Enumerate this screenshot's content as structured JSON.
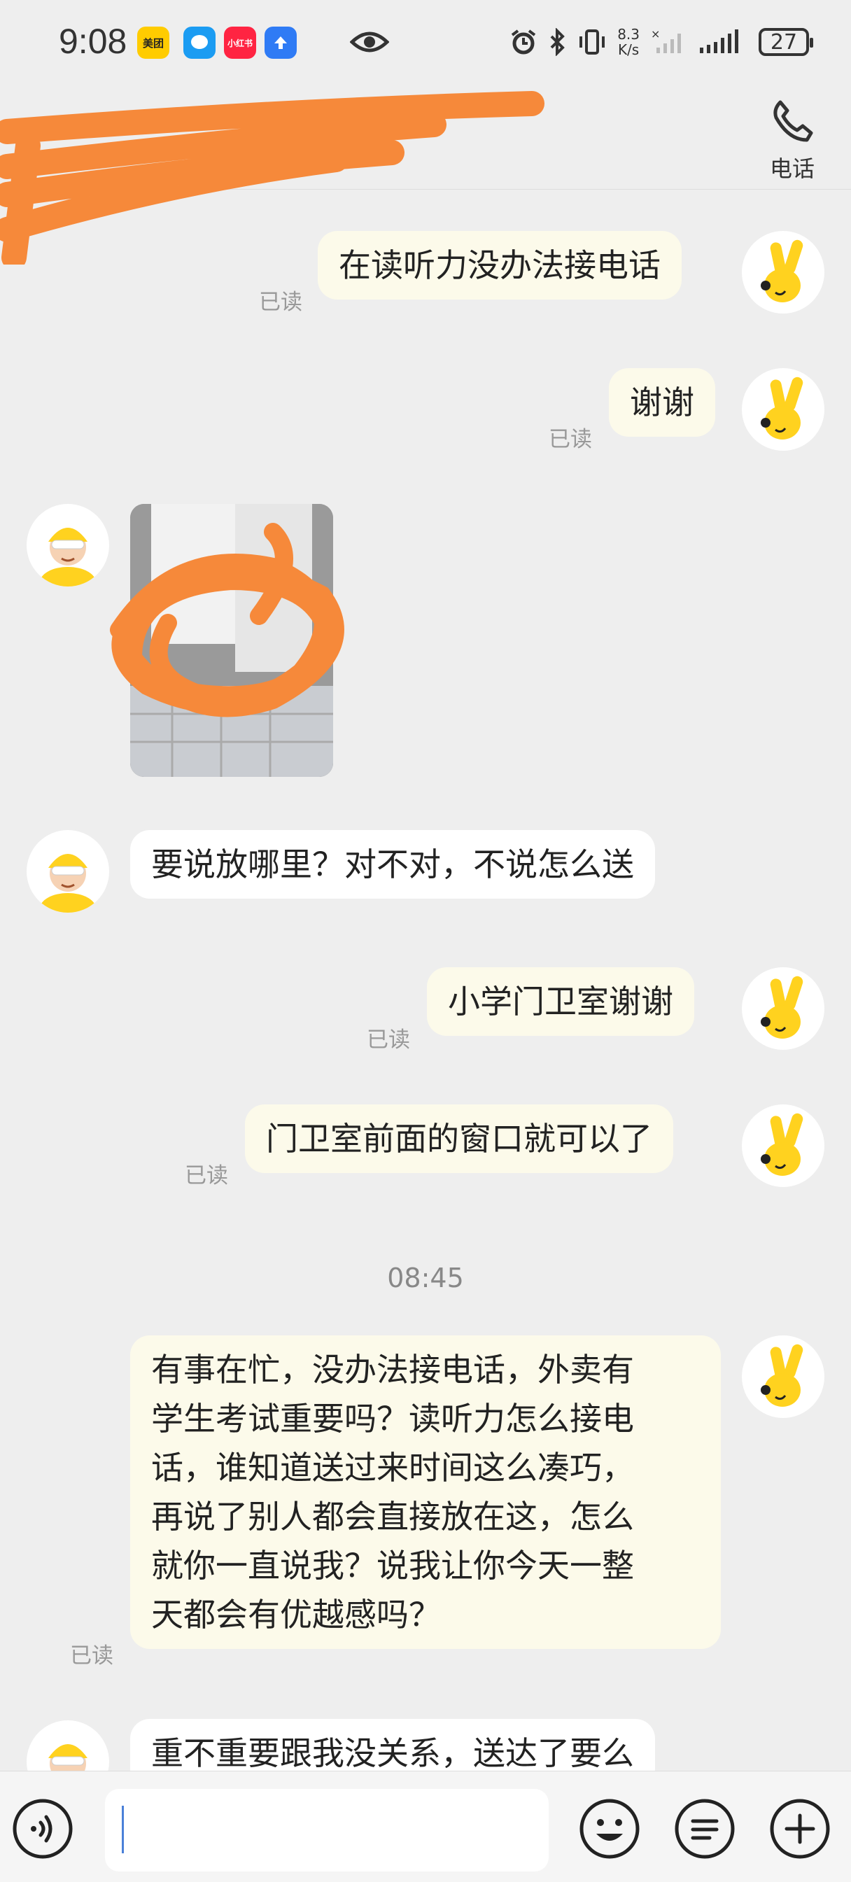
{
  "status_bar": {
    "time": "9:08",
    "apps": [
      {
        "name": "美团",
        "color": "#ffcc00"
      },
      {
        "name": "messages",
        "color": "#1b9cf2"
      },
      {
        "name": "小红书",
        "color": "#ff2442"
      },
      {
        "name": "upload",
        "color": "#2f7bf5"
      }
    ],
    "net_speed_value": "8.3",
    "net_speed_unit": "K/s",
    "battery": "27"
  },
  "header": {
    "call_label": "电话"
  },
  "messages": [
    {
      "from": "me",
      "text": "在读听力没办法接电话",
      "read": "已读"
    },
    {
      "from": "me",
      "text": "谢谢",
      "read": "已读"
    },
    {
      "from": "them",
      "type": "image"
    },
    {
      "from": "them",
      "text": "要说放哪里？对不对，不说怎么送"
    },
    {
      "from": "me",
      "text": "小学门卫室谢谢",
      "read": "已读"
    },
    {
      "from": "me",
      "text": "门卫室前面的窗口就可以了",
      "read": "已读"
    },
    {
      "from": "me",
      "lines": [
        "有事在忙，没办法接电话，外卖有",
        "学生考试重要吗？读听力怎么接电",
        "话，谁知道送过来时间这么凑巧，",
        "再说了别人都会直接放在这，怎么",
        "就你一直说我？说我让你今天一整",
        "天都会有优越感吗？"
      ],
      "read": "已读"
    },
    {
      "from": "them",
      "text": "重不重要跟我没关系，送达了要么"
    }
  ],
  "timestamp": "08:45",
  "input_bar": {
    "value": "",
    "tools": [
      "voice-icon",
      "emoji-icon",
      "quick-reply-icon",
      "plus-icon"
    ]
  },
  "colors": {
    "my_bubble": "#fcfaea",
    "their_bubble": "#ffffff",
    "background": "#eeeeee",
    "redaction": "#f6893a"
  }
}
